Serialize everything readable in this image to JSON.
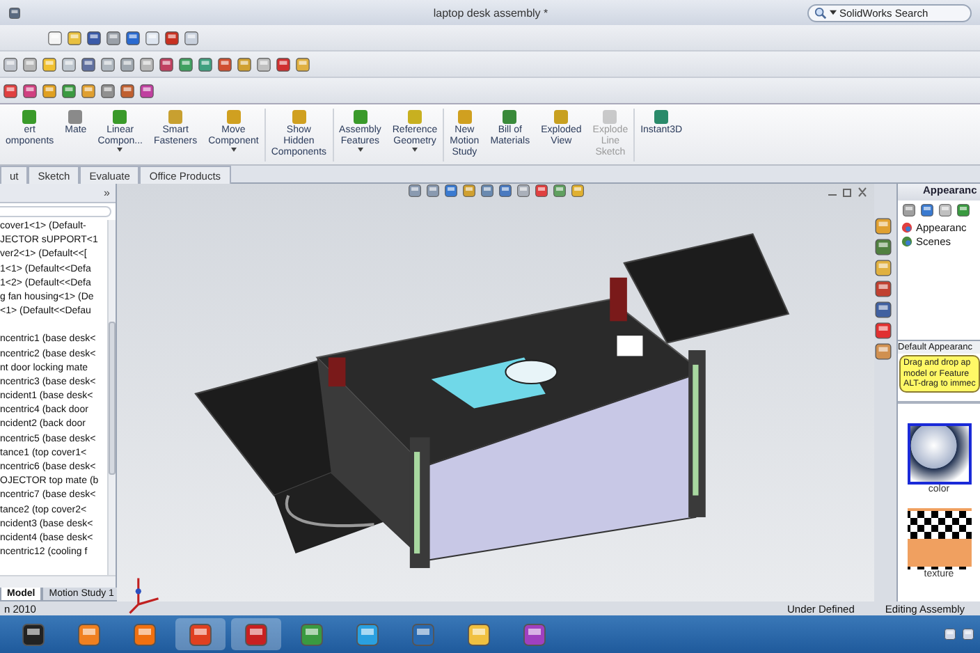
{
  "window": {
    "title": "laptop desk assembly *"
  },
  "search": {
    "placeholder": "SolidWorks Search"
  },
  "ribbon": [
    {
      "label": "ert\nomponents",
      "dropdown": false,
      "disabled": false
    },
    {
      "label": "Mate",
      "dropdown": false,
      "disabled": false
    },
    {
      "label": "Linear\nCompon...",
      "dropdown": true,
      "disabled": false
    },
    {
      "label": "Smart\nFasteners",
      "dropdown": false,
      "disabled": false
    },
    {
      "label": "Move\nComponent",
      "dropdown": true,
      "disabled": false
    },
    {
      "label": "Show\nHidden\nComponents",
      "dropdown": false,
      "disabled": false
    },
    {
      "label": "Assembly\nFeatures",
      "dropdown": true,
      "disabled": false
    },
    {
      "label": "Reference\nGeometry",
      "dropdown": true,
      "disabled": false
    },
    {
      "label": "New\nMotion\nStudy",
      "dropdown": false,
      "disabled": false
    },
    {
      "label": "Bill of\nMaterials",
      "dropdown": false,
      "disabled": false
    },
    {
      "label": "Exploded\nView",
      "dropdown": false,
      "disabled": false
    },
    {
      "label": "Explode\nLine\nSketch",
      "dropdown": false,
      "disabled": true
    },
    {
      "label": "Instant3D",
      "dropdown": false,
      "disabled": false
    }
  ],
  "tabs": [
    {
      "label": "ut",
      "selected": false
    },
    {
      "label": "Sketch",
      "selected": false
    },
    {
      "label": "Evaluate",
      "selected": false
    },
    {
      "label": "Office Products",
      "selected": false
    }
  ],
  "feature_tree": {
    "expand": "»",
    "components": [
      "cover1<1> (Default-",
      "JECTOR sUPPORT<1",
      "ver2<1> (Default<<[",
      "1<1> (Default<<Defa",
      "1<2> (Default<<Defa",
      "g fan housing<1> (De",
      "<1> (Default<<Defau"
    ],
    "mates": [
      "ncentric1 (base desk<",
      "ncentric2 (base desk<",
      "nt door locking mate",
      "ncentric3 (base desk<",
      "ncident1 (base desk<",
      "ncentric4 (back door",
      "ncident2 (back door",
      "ncentric5 (base desk<",
      "tance1 (top cover1<",
      "ncentric6 (base desk<",
      "OJECTOR top mate (b",
      "ncentric7 (base desk<",
      "tance2 (top cover2<",
      "ncident3 (base desk<",
      "ncident4 (base desk<",
      "ncentric12 (cooling f"
    ]
  },
  "bottom_tabs": [
    {
      "label": "Model",
      "selected": true
    },
    {
      "label": "Motion Study 1",
      "selected": false
    }
  ],
  "task_pane": {
    "title": "Appearanc",
    "tree": [
      "Appearanc",
      "Scenes"
    ],
    "section": "Default Appearanc",
    "tooltip": "Drag and drop ap\nmodel or Feature\nALT-drag to immec",
    "swatches": [
      {
        "label": "color",
        "kind": "sphere",
        "selected": true
      },
      {
        "label": "texture",
        "kind": "texture",
        "selected": false
      }
    ]
  },
  "status_bar": {
    "left": "n 2010",
    "state": "Under Defined",
    "mode": "Editing Assembly"
  }
}
